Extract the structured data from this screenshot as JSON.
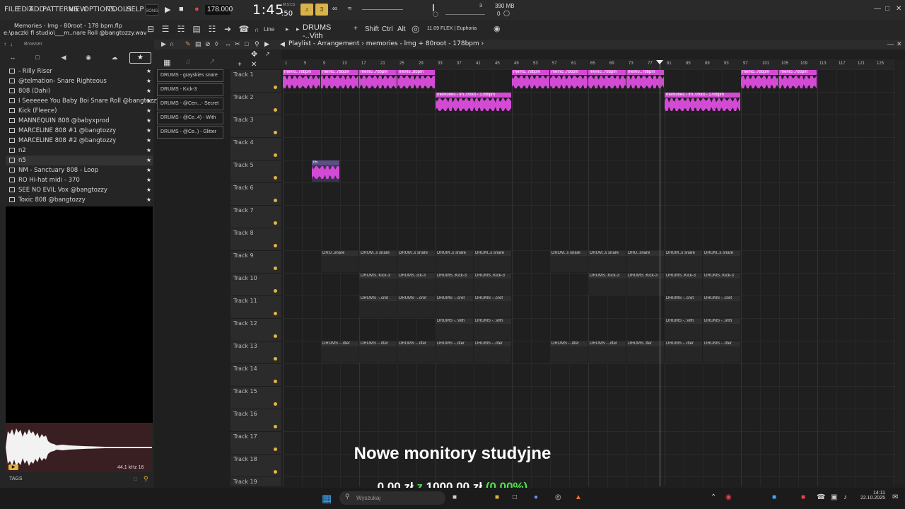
{
  "menu": [
    "FILE",
    "EDIT",
    "ADD",
    "PATTERNS",
    "VIEW",
    "OPTIONS",
    "TOOLS",
    "HELP"
  ],
  "transport": {
    "song_label": "SONG",
    "tempo": "178.000",
    "time": "1:45",
    "time_sub": ":50",
    "time_unit": "M:S:CS",
    "memory": "390 MB",
    "cpu_counter": "3",
    "ram_counter": "0"
  },
  "title": {
    "filename": "Memories - lmg - 80root - 178 bpm.flp",
    "filepath": "e:\\paczki fl studio\\___m..nare Roll @bangtozzy.wav",
    "snap": "Line",
    "pattern": "DRUMS -..Vith",
    "keys": [
      "Shift",
      "Ctrl",
      "Alt"
    ],
    "plugin": "11.09  FLEX | Euphoria"
  },
  "browser": {
    "title": "Browser",
    "items": [
      {
        "label": "- Rilly Riser",
        "sel": false
      },
      {
        "label": "@telmation- Snare Righteous",
        "sel": false
      },
      {
        "label": "808 (Dahi)",
        "sel": false
      },
      {
        "label": "I Seeeeee You Baby Boi Snare Roll @bangtozzy",
        "sel": false
      },
      {
        "label": "Kick (Fleece)",
        "sel": false
      },
      {
        "label": "MANNEQUIN 808 @babyxprod",
        "sel": false
      },
      {
        "label": "MARCELINE 808 #1 @bangtozzy",
        "sel": false
      },
      {
        "label": "MARCELINE 808 #2 @bangtozzy",
        "sel": false
      },
      {
        "label": "n2",
        "sel": false
      },
      {
        "label": "n5",
        "sel": true
      },
      {
        "label": "NM - Sanctuary 808 - Loop",
        "sel": false
      },
      {
        "label": "RO Hi-hat midi - 370",
        "sel": false
      },
      {
        "label": "SEE NO EVIL Vox @bangtozzy",
        "sel": false
      },
      {
        "label": "Toxic 808 @bangtozzy",
        "sel": false
      }
    ],
    "sample_info": "44.1 kHz 16",
    "tags_label": "TAGS"
  },
  "playlist": {
    "title": "Playlist - Arrangement",
    "breadcrumb": "memories - lmg + 80root - 178bpm",
    "patterns": [
      "DRUMS - grayskies snare",
      "DRUMS - Kick-3",
      "DRUMS - @Cen...- Secret",
      "DRUMS - @Ce..4) - With",
      "DRUMS - @Ce..) - Glitter"
    ],
    "ruler_ticks": [
      "1",
      "5",
      "9",
      "13",
      "17",
      "21",
      "25",
      "29",
      "33",
      "37",
      "41",
      "45",
      "49",
      "53",
      "57",
      "61",
      "65",
      "69",
      "73",
      "77",
      "81",
      "85",
      "89",
      "93",
      "97",
      "101",
      "105",
      "109",
      "113",
      "117",
      "121",
      "125"
    ],
    "tracks": [
      "Track 1",
      "Track 2",
      "Track 3",
      "Track 4",
      "Track 5",
      "Track 6",
      "Track 7",
      "Track 8",
      "Track 9",
      "Track 10",
      "Track 11",
      "Track 12",
      "Track 13",
      "Track 14",
      "Track 15",
      "Track 16",
      "Track 17",
      "Track 18",
      "Track 19"
    ],
    "clips": [
      {
        "track": 0,
        "start": 1,
        "end": 33,
        "kind": "audio",
        "labels": [
          "memo..78bpm",
          "memo..78bpm",
          "memo..78bpm",
          "memo..8bpm"
        ]
      },
      {
        "track": 0,
        "start": 49,
        "end": 81,
        "kind": "audio",
        "labels": [
          "memo..78bpm",
          "memo..78bpm",
          "memo..78bpm",
          "memo..78bpm"
        ]
      },
      {
        "track": 0,
        "start": 97,
        "end": 113,
        "kind": "audio",
        "labels": [
          "memo..78bpm",
          "memo..78bpm"
        ]
      },
      {
        "track": 1,
        "start": 33,
        "end": 49,
        "kind": "audio",
        "labels": [
          "memories - lm..0root - 178bpm"
        ]
      },
      {
        "track": 1,
        "start": 81,
        "end": 97,
        "kind": "audio",
        "labels": [
          "memories - lm..0root - 178bpm"
        ]
      },
      {
        "track": 4,
        "start": 7,
        "end": 13,
        "kind": "audio",
        "labels": [
          "n5"
        ]
      },
      {
        "track": 8,
        "start": 9,
        "end": 17,
        "kind": "pat",
        "labels": [
          "DRU..snare"
        ]
      },
      {
        "track": 8,
        "start": 17,
        "end": 49,
        "kind": "pat",
        "labels": [
          "DRUM..s snare",
          "DRUM..s snare",
          "DRUM..s snare",
          "DRUM..s snare"
        ]
      },
      {
        "track": 8,
        "start": 57,
        "end": 81,
        "kind": "pat",
        "labels": [
          "DRUM..s snare",
          "DRUM..s snare",
          "DRU..snare"
        ]
      },
      {
        "track": 8,
        "start": 81,
        "end": 97,
        "kind": "pat",
        "labels": [
          "DRUM..s snare",
          "DRUM..s snare"
        ]
      },
      {
        "track": 9,
        "start": 17,
        "end": 49,
        "kind": "pat",
        "labels": [
          "DRUMS..Kick-3",
          "DRUMS..ick-3",
          "DRUMS..Kick-3",
          "DRUMS..Kick-3"
        ]
      },
      {
        "track": 9,
        "start": 65,
        "end": 81,
        "kind": "pat",
        "labels": [
          "DRUMS..Kick-3",
          "DRUMS..Kick-3"
        ]
      },
      {
        "track": 9,
        "start": 81,
        "end": 97,
        "kind": "pat",
        "labels": [
          "DRUMS..Kick-3",
          "DRUMS..Kick-3"
        ]
      },
      {
        "track": 10,
        "start": 17,
        "end": 49,
        "kind": "pat",
        "labels": [
          "DRUMS -..cret",
          "DRUMS -..cret",
          "DRUMS -..cret",
          "DRUMS -..cret"
        ]
      },
      {
        "track": 10,
        "start": 81,
        "end": 97,
        "kind": "pat",
        "labels": [
          "DRUMS -..cret",
          "DRUMS -..cret"
        ]
      },
      {
        "track": 11,
        "start": 33,
        "end": 49,
        "kind": "pat",
        "labels": [
          "DRUMS -..Vith",
          "DRUMS -..Vith"
        ]
      },
      {
        "track": 11,
        "start": 81,
        "end": 97,
        "kind": "pat",
        "labels": [
          "DRUMS -..Vith",
          "DRUMS -..Vith"
        ]
      },
      {
        "track": 12,
        "start": 9,
        "end": 49,
        "kind": "pat",
        "labels": [
          "DRUMS -..itter",
          "DRUMS -..itter",
          "DRUMS -..itter",
          "DRUMS -..itter",
          "DRUMS -..itter"
        ]
      },
      {
        "track": 12,
        "start": 57,
        "end": 81,
        "kind": "pat",
        "labels": [
          "DRUMS -..itter",
          "DRUMS -..itter",
          "DRUMS..tter"
        ]
      },
      {
        "track": 12,
        "start": 81,
        "end": 97,
        "kind": "pat",
        "labels": [
          "DRUMS -..itter",
          "DRUMS -..itter"
        ]
      }
    ],
    "playhead_bar": 80
  },
  "overlay": {
    "title": "Nowe monitory studyjne",
    "amount": "0,00 zł",
    "z": "z",
    "goal": "1000,00 zł",
    "percent": "(0.00%)"
  },
  "taskbar": {
    "search_placeholder": "Wyszukaj",
    "time": "14:11",
    "date": "22.10.2025"
  },
  "colors": {
    "accent_audio": "#d34bd4",
    "track_led": "#e7b43c",
    "overlay_green": "#4ce24c"
  }
}
